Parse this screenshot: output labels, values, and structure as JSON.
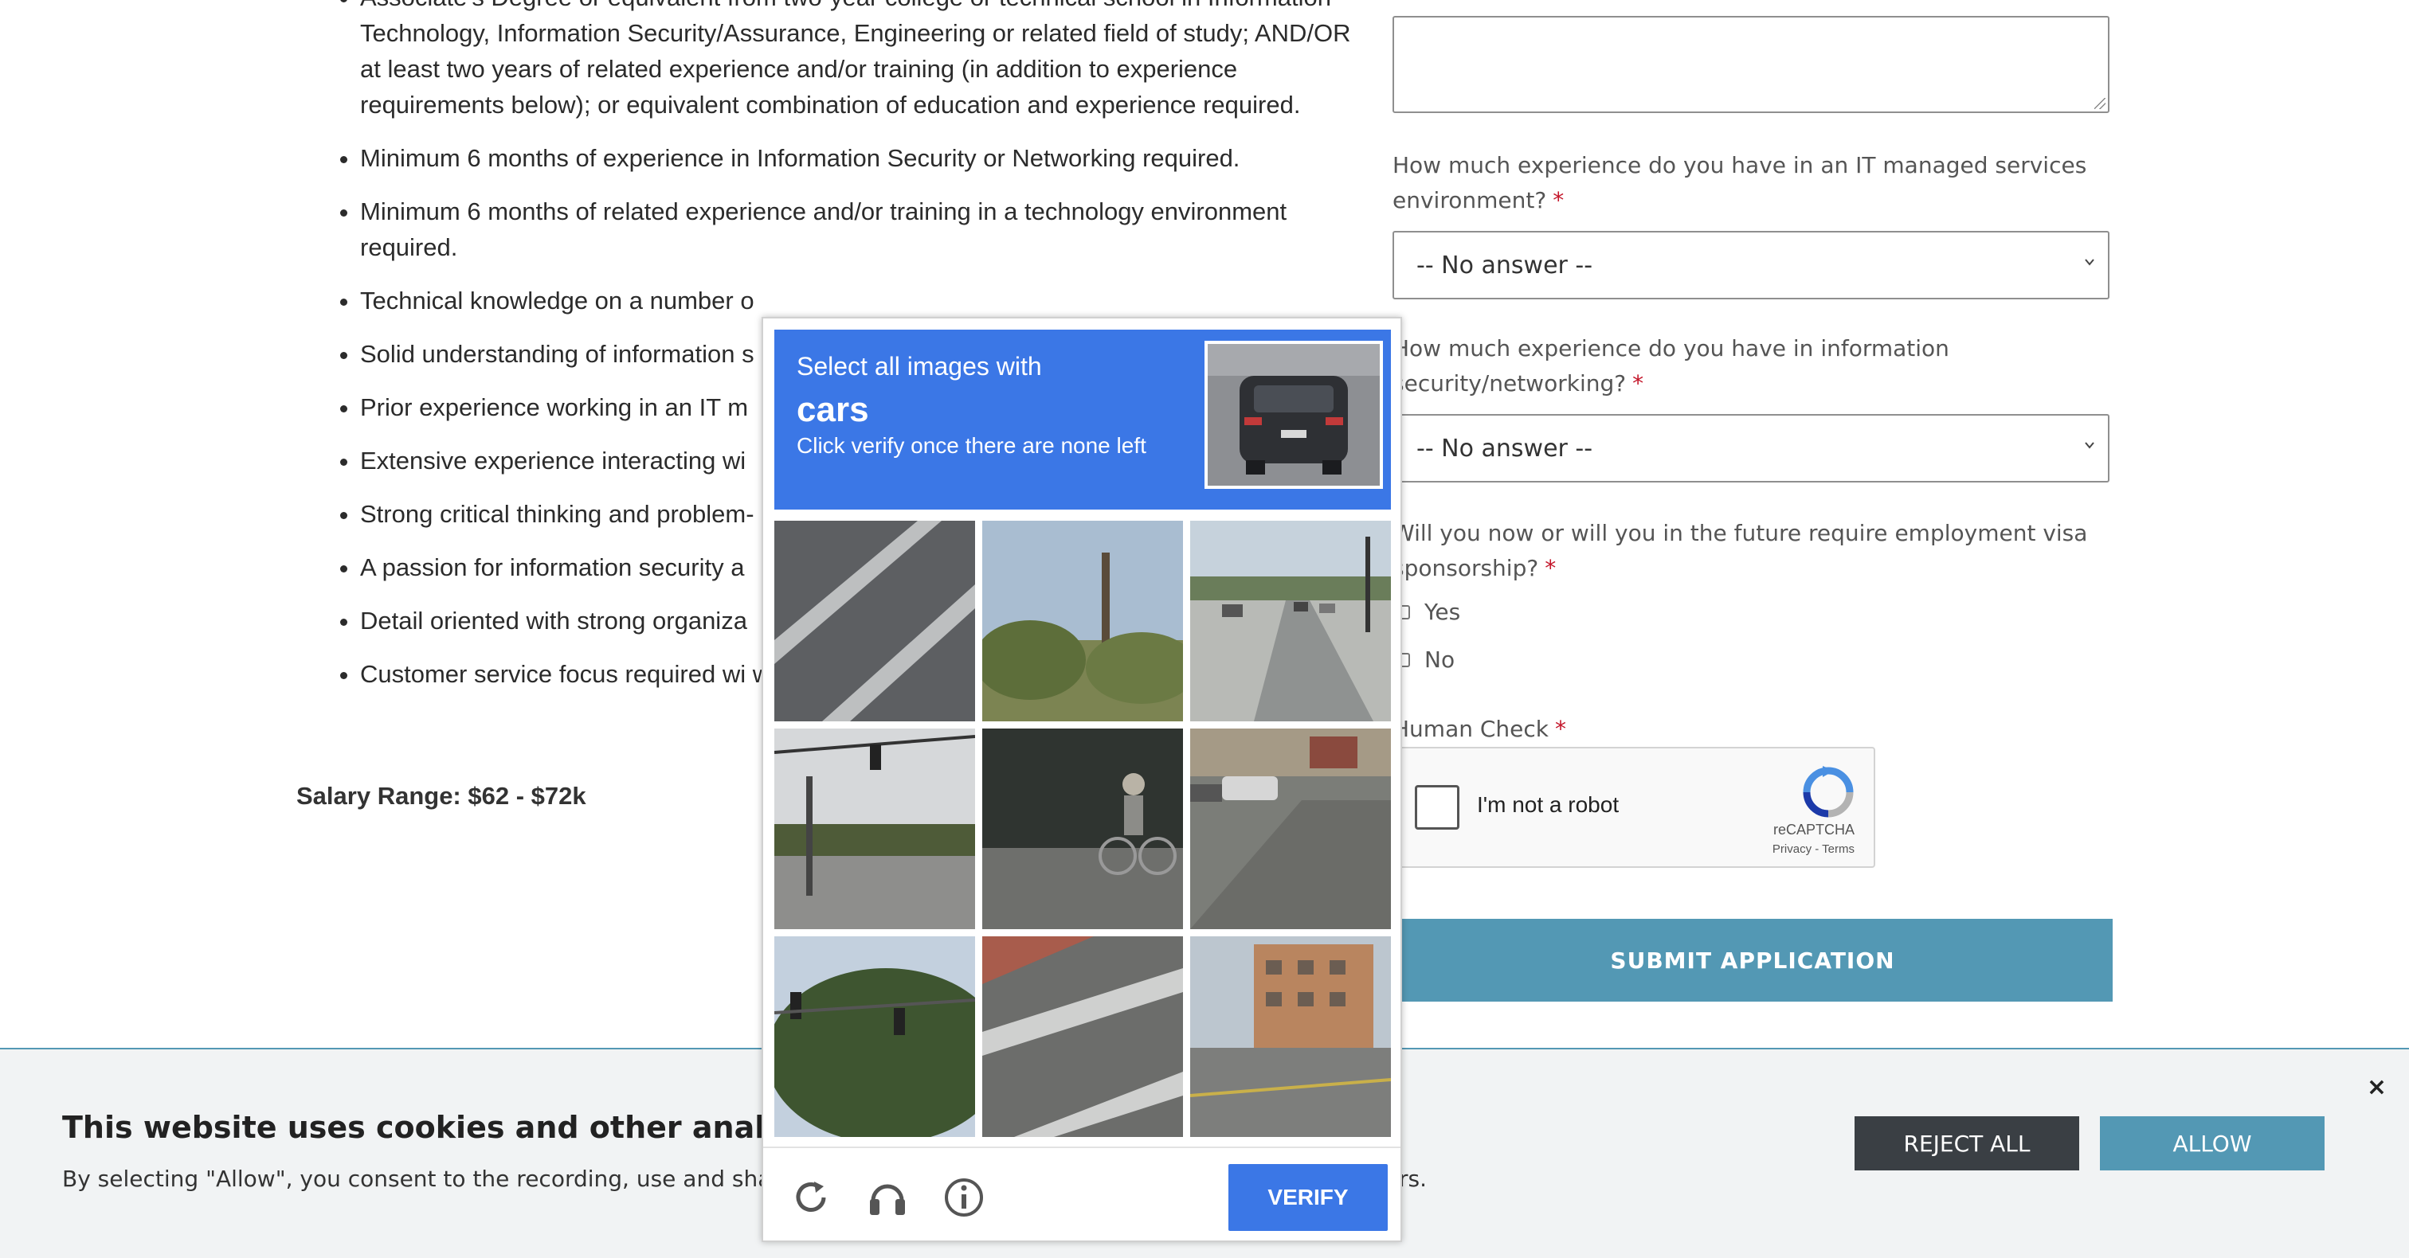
{
  "job": {
    "requirements": [
      "Associate's Degree or equivalent from two-year college or technical school in Information Technology, Information Security/Assurance, Engineering or related field of study; AND/OR at least two years of related experience and/or training (in addition to experience requirements below); or equivalent combination of education and experience required.",
      "Minimum 6 months of experience in Information Security or Networking required.",
      "Minimum 6 months of related experience and/or training in a technology environment required.",
      "Technical knowledge on a number o",
      "Solid understanding of information s",
      "Prior experience working in an IT m",
      "Extensive experience interacting wi",
      "Strong critical thinking and problem-",
      "A passion for information security a",
      "Detail oriented with strong organiza",
      "Customer service focus required wi written/verbal communication skills."
    ],
    "salary": "Salary Range: $62 - $72k"
  },
  "form": {
    "q1_label": "How much experience do you have in an IT managed services environment?",
    "q1_value": "-- No answer --",
    "q2_label": "How much experience do you have in information security/networking?",
    "q2_value": "-- No answer --",
    "q3_label": "Will you now or will you in the future require employment visa sponsorship?",
    "q3_options": [
      "Yes",
      "No"
    ],
    "human_check_label": "Human Check",
    "required_mark": "*",
    "submit_label": "SUBMIT APPLICATION"
  },
  "recaptcha": {
    "label": "I'm not a robot",
    "brand": "reCAPTCHA",
    "terms": "Privacy - Terms"
  },
  "challenge": {
    "instruction": "Select all images with",
    "target": "cars",
    "subinstruction": "Click verify once there are none left",
    "verify_label": "VERIFY",
    "tiles": [
      "road-lines",
      "trees",
      "street-cars",
      "traffic-light-road",
      "cyclist",
      "parked-cars",
      "tree-traffic-light",
      "crosswalk",
      "hotel-road"
    ]
  },
  "cookie": {
    "title": "This website uses cookies and other analytics techn",
    "text": "By selecting \"Allow\", you consent to the recording, use and sharing",
    "text_tail": "rs.",
    "reject_label": "REJECT ALL",
    "allow_label": "ALLOW",
    "close_glyph": "×"
  },
  "colors": {
    "captcha_blue": "#3b77e6",
    "submit_teal": "#5398b4",
    "required_red": "#c4162a",
    "reject_dark": "#3a3f44"
  }
}
